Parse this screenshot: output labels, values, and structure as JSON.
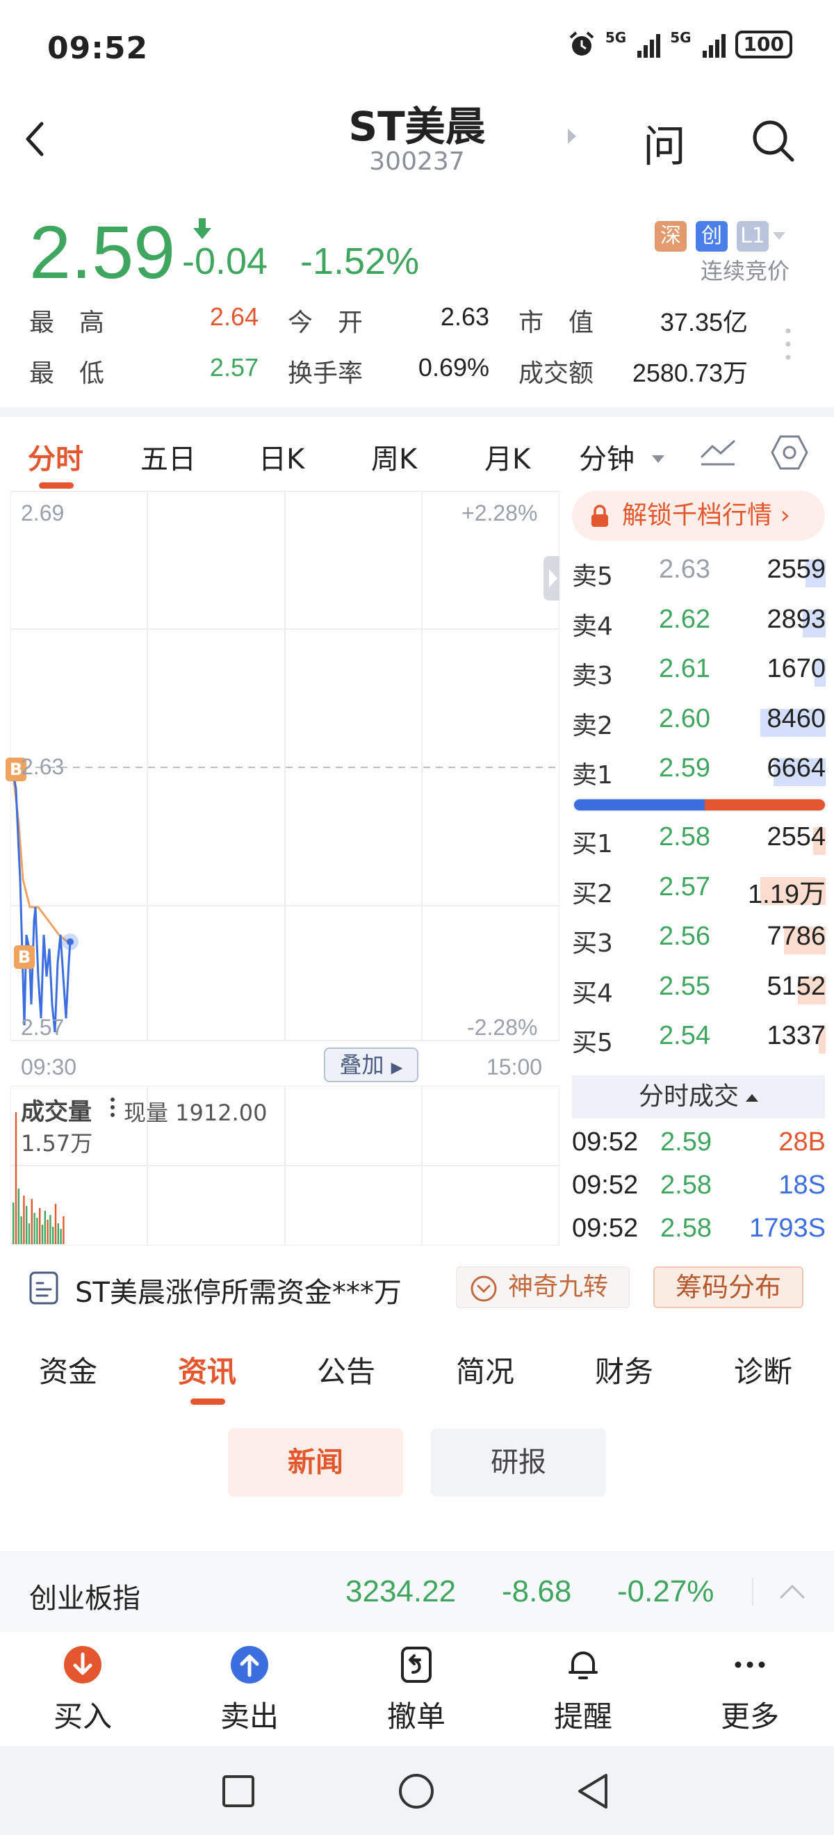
{
  "status_bar": {
    "time": "09:52",
    "net1": "5G",
    "net2": "5G",
    "battery": "100"
  },
  "header": {
    "name": "ST美晨",
    "code": "300237",
    "ask_label": "问"
  },
  "quote": {
    "price": "2.59",
    "change": "-0.04",
    "change_pct": "-1.52%",
    "badge_market": "深",
    "badge_board": "创",
    "badge_level": "L1",
    "trade_mode": "连续竞价",
    "stats": {
      "high_label": "最　高",
      "high": "2.64",
      "open_label": "今　开",
      "open": "2.63",
      "mcap_label": "市　值",
      "mcap": "37.35亿",
      "low_label": "最　低",
      "low": "2.57",
      "turnover_label": "换手率",
      "turnover": "0.69%",
      "amount_label": "成交额",
      "amount": "2580.73万"
    }
  },
  "chart_tabs": [
    "分时",
    "五日",
    "日K",
    "周K",
    "月K",
    "分钟"
  ],
  "chart": {
    "y_top": "2.69",
    "y_mid": "2.63",
    "y_bottom": "2.57",
    "pct_top": "+2.28%",
    "pct_bottom": "-2.28%",
    "x_start": "09:30",
    "x_end": "15:00",
    "overlay_label": "叠加",
    "marker_label": "B"
  },
  "volume": {
    "title": "成交量",
    "current": "现量 1912.00",
    "max": "1.57万"
  },
  "order_book": {
    "unlock_label": "解锁千档行情",
    "asks": [
      {
        "label": "卖5",
        "price": "2.63",
        "vol": "2559",
        "fill": 0.22
      },
      {
        "label": "卖4",
        "price": "2.62",
        "vol": "2893",
        "fill": 0.25
      },
      {
        "label": "卖3",
        "price": "2.61",
        "vol": "1670",
        "fill": 0.12
      },
      {
        "label": "卖2",
        "price": "2.60",
        "vol": "8460",
        "fill": 0.72
      },
      {
        "label": "卖1",
        "price": "2.59",
        "vol": "6664",
        "fill": 0.58
      }
    ],
    "bids": [
      {
        "label": "买1",
        "price": "2.58",
        "vol": "2554",
        "fill": 0.14
      },
      {
        "label": "买2",
        "price": "2.57",
        "vol": "1.19万",
        "fill": 0.72
      },
      {
        "label": "买3",
        "price": "2.56",
        "vol": "7786",
        "fill": 0.46
      },
      {
        "label": "买4",
        "price": "2.55",
        "vol": "5152",
        "fill": 0.31
      },
      {
        "label": "买5",
        "price": "2.54",
        "vol": "1337",
        "fill": 0.08
      }
    ],
    "ticks_title": "分时成交",
    "ticks": [
      {
        "time": "09:52",
        "price": "2.59",
        "vol": "28B",
        "side": "buy"
      },
      {
        "time": "09:52",
        "price": "2.58",
        "vol": "18S",
        "side": "sell"
      },
      {
        "time": "09:52",
        "price": "2.58",
        "vol": "1793S",
        "side": "sell"
      }
    ]
  },
  "features": {
    "limit_text": "ST美晨涨停所需资金***万",
    "magic_label": "神奇九转",
    "chips_label": "筹码分布"
  },
  "info_tabs": [
    "资金",
    "资讯",
    "公告",
    "简况",
    "财务",
    "诊断"
  ],
  "sub_tabs": {
    "news": "新闻",
    "report": "研报"
  },
  "index_bar": {
    "name": "创业板指",
    "value": "3234.22",
    "change": "-8.68",
    "pct": "-0.27%"
  },
  "actions": {
    "buy": "买入",
    "sell": "卖出",
    "cancel": "撤单",
    "alert": "提醒",
    "more": "更多"
  },
  "colors": {
    "up": "#e4572e",
    "down": "#3fa65f",
    "accent": "#e4572e",
    "blue": "#3d6ee0"
  }
}
